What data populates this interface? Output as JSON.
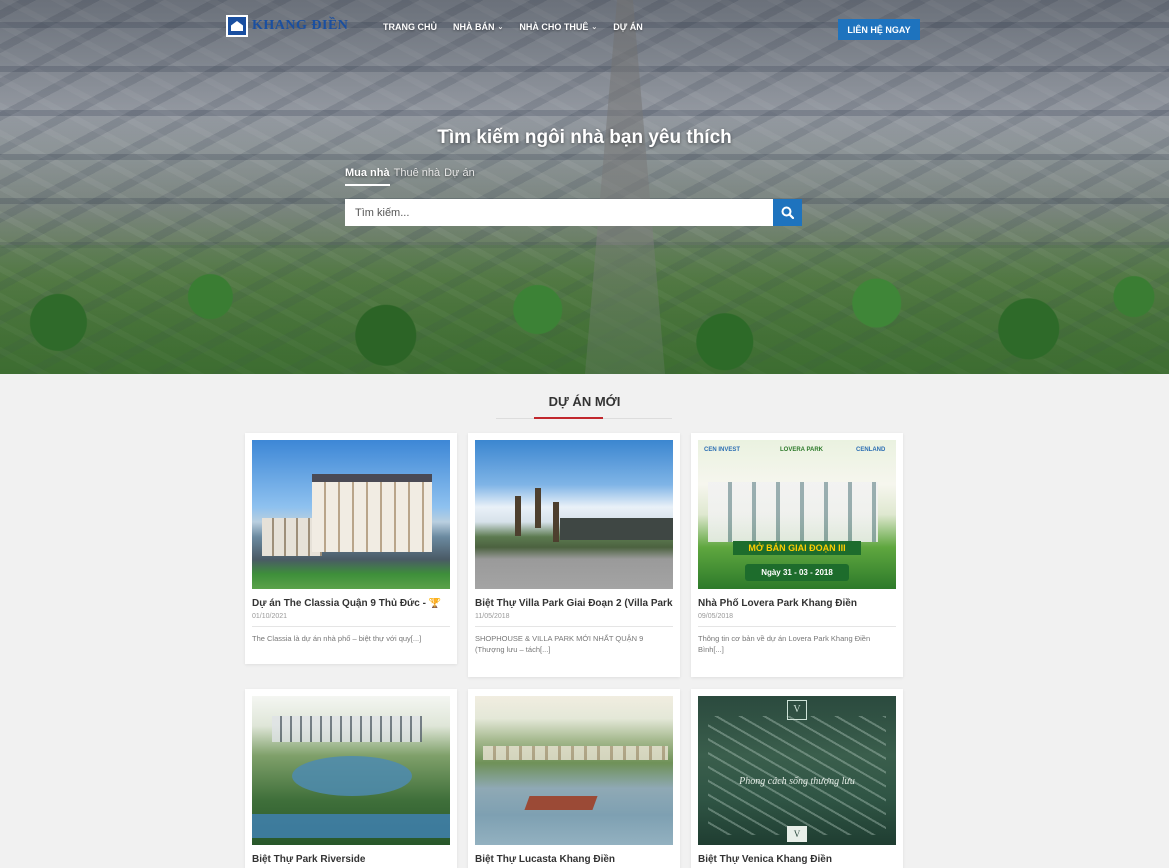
{
  "header": {
    "logo_text": "Khang Điền",
    "nav": [
      {
        "label": "Trang chủ",
        "has_dropdown": false
      },
      {
        "label": "Nhà bán",
        "has_dropdown": true
      },
      {
        "label": "Nhà cho thuê",
        "has_dropdown": true
      },
      {
        "label": "Dự án",
        "has_dropdown": false
      }
    ],
    "cta_label": "Liên hệ ngay"
  },
  "hero": {
    "title": "Tìm kiếm ngôi nhà bạn yêu thích",
    "tabs": [
      {
        "label": "Mua nhà",
        "active": true
      },
      {
        "label": "Thuê nhà",
        "active": false
      },
      {
        "label": "Dự án",
        "active": false
      }
    ],
    "search_placeholder": "Tìm kiếm..."
  },
  "section": {
    "title": "Dự án mới"
  },
  "cards": [
    {
      "title": "Dự án The Classia Quận 9 Thủ Đức - 🏆",
      "date": "01/10/2021",
      "excerpt": "The Classia là dự án nhà phố – biệt thự với quy[...]"
    },
    {
      "title": "Biệt Thự Villa Park Giai Đoạn 2 (Villa Park",
      "date": "11/05/2018",
      "excerpt": "SHOPHOUSE & VILLA PARK MỚI NHẤT QUẬN 9 (Thượng lưu – tách[...]"
    },
    {
      "title": "Nhà Phố Lovera Park Khang Điền",
      "date": "09/05/2018",
      "excerpt": "Thông tin cơ bản về dự án Lovera Park Khang Điền Bình[...]",
      "image_text": {
        "brand_left": "CEN INVEST",
        "brand_mid": "LOVERA PARK",
        "brand_right": "CENLAND",
        "banner": "MỞ BÁN GIAI ĐOẠN III",
        "date_badge": "Ngày 31 - 03 - 2018"
      }
    },
    {
      "title": "Biệt Thự Park Riverside",
      "date": "",
      "excerpt": ""
    },
    {
      "title": "Biệt Thự Lucasta Khang Điền",
      "date": "",
      "excerpt": ""
    },
    {
      "title": "Biệt Thự Venica Khang Điền",
      "date": "",
      "excerpt": "",
      "image_text": {
        "slogan": "Phong cách sống thượng lưu",
        "logo": "V"
      }
    }
  ]
}
